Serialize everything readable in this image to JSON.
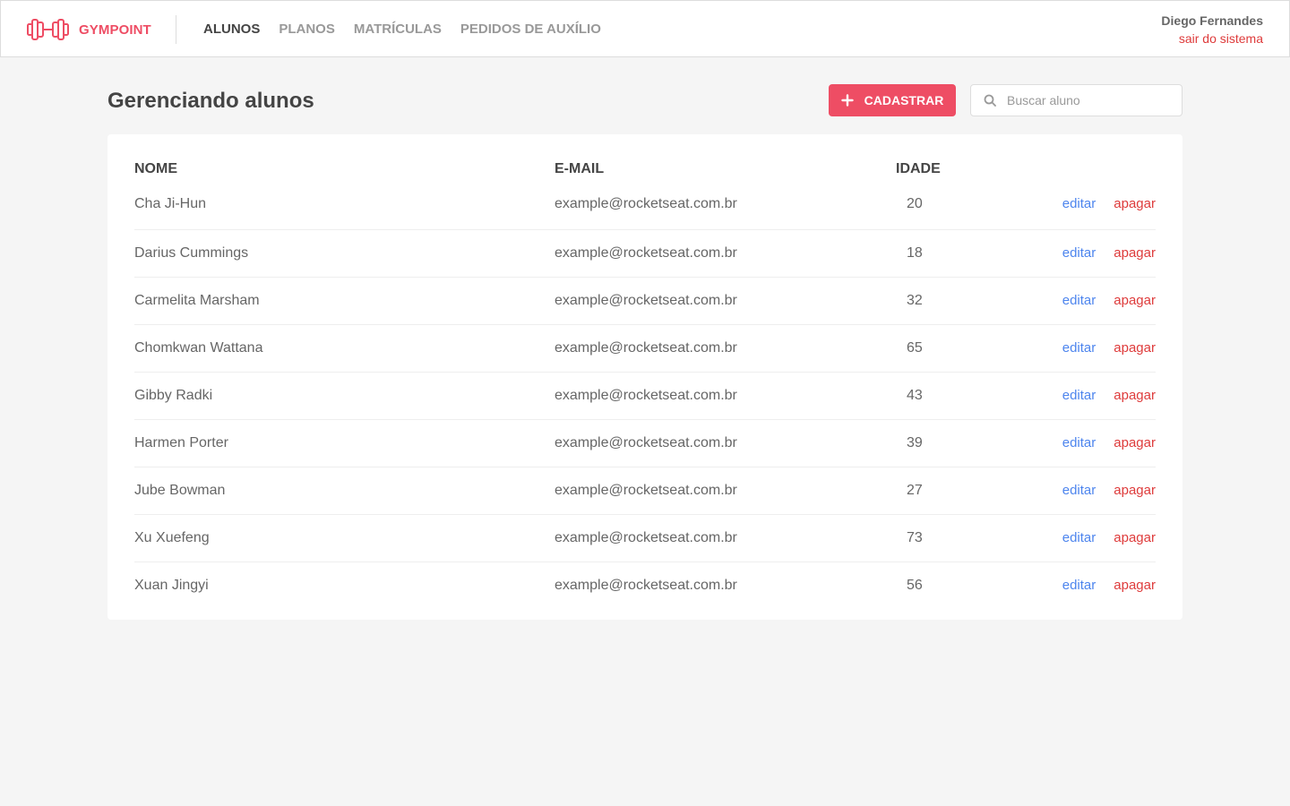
{
  "header": {
    "brand": "GYMPOINT",
    "nav": [
      {
        "label": "ALUNOS",
        "active": true
      },
      {
        "label": "PLANOS",
        "active": false
      },
      {
        "label": "MATRÍCULAS",
        "active": false
      },
      {
        "label": "PEDIDOS DE AUXÍLIO",
        "active": false
      }
    ],
    "user_name": "Diego Fernandes",
    "logout_label": "sair do sistema"
  },
  "page": {
    "title": "Gerenciando alunos",
    "add_button_label": "CADASTRAR",
    "search_placeholder": "Buscar aluno"
  },
  "table": {
    "headers": {
      "name": "NOME",
      "email": "E-MAIL",
      "age": "IDADE"
    },
    "edit_label": "editar",
    "delete_label": "apagar",
    "rows": [
      {
        "name": "Cha Ji-Hun",
        "email": "example@rocketseat.com.br",
        "age": "20"
      },
      {
        "name": "Darius Cummings",
        "email": "example@rocketseat.com.br",
        "age": "18"
      },
      {
        "name": "Carmelita Marsham",
        "email": "example@rocketseat.com.br",
        "age": "32"
      },
      {
        "name": "Chomkwan Wattana",
        "email": "example@rocketseat.com.br",
        "age": "65"
      },
      {
        "name": "Gibby Radki",
        "email": "example@rocketseat.com.br",
        "age": "43"
      },
      {
        "name": "Harmen Porter",
        "email": "example@rocketseat.com.br",
        "age": "39"
      },
      {
        "name": "Jube Bowman",
        "email": "example@rocketseat.com.br",
        "age": "27"
      },
      {
        "name": "Xu Xuefeng",
        "email": "example@rocketseat.com.br",
        "age": "73"
      },
      {
        "name": "Xuan Jingyi",
        "email": "example@rocketseat.com.br",
        "age": "56"
      }
    ]
  },
  "colors": {
    "brand": "#ee4d64",
    "edit": "#4d85ee",
    "delete": "#de3b3b",
    "background": "#f5f5f5"
  },
  "icons": {
    "logo": "dumbbell-icon",
    "add": "plus-icon",
    "search": "search-icon"
  }
}
